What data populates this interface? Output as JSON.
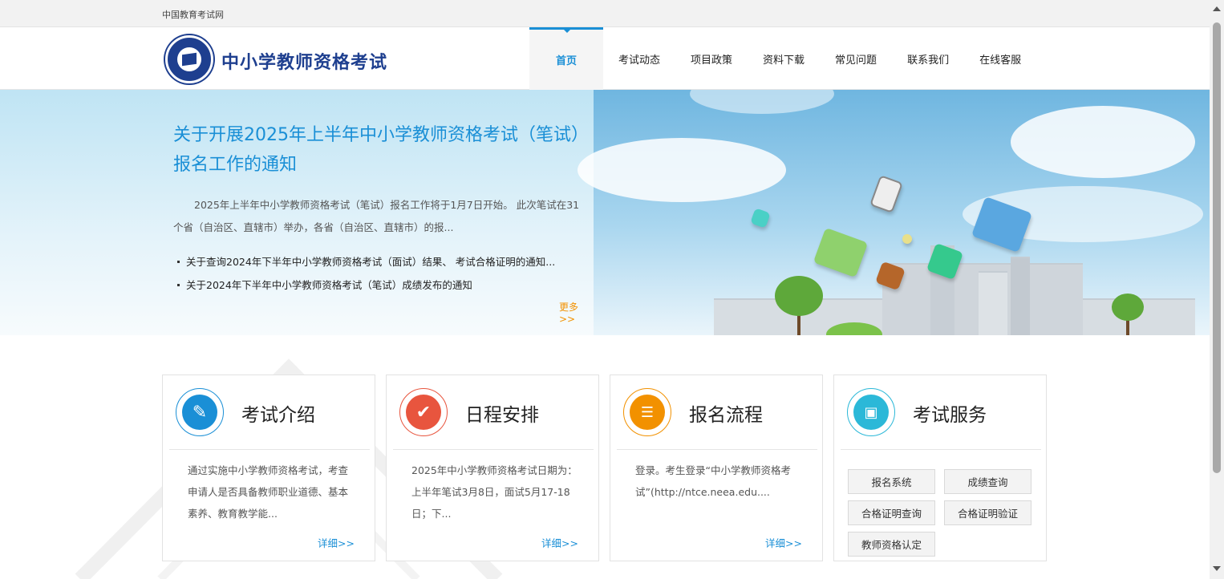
{
  "topbar": {
    "site_link": "中国教育考试网"
  },
  "header": {
    "title": "中小学教师资格考试",
    "nav": [
      "首页",
      "考试动态",
      "项目政策",
      "资料下载",
      "常见问题",
      "联系我们",
      "在线客服"
    ]
  },
  "banner": {
    "headline": "关于开展2025年上半年中小学教师资格考试（笔试）报名工作的通知",
    "summary": "2025年上半年中小学教师资格考试（笔试）报名工作将于1月7日开始。 此次笔试在31个省（自治区、直辖市）举办，各省（自治区、直辖市）的报...",
    "news": [
      "关于查询2024年下半年中小学教师资格考试（面试）结果、 考试合格证明的通知...",
      "关于2024年下半年中小学教师资格考试（笔试）成绩发布的通知"
    ],
    "more": "更多>>"
  },
  "cards": [
    {
      "title": "考试介绍",
      "text": "通过实施中小学教师资格考试，考查申请人是否具备教师职业道德、基本素养、教育教学能...",
      "more": "详细>>",
      "color": "#1a8fd6"
    },
    {
      "title": "日程安排",
      "text": "2025年中小学教师资格考试日期为：上半年笔试3月8日，面试5月17-18日；下...",
      "more": "详细>>",
      "color": "#e8553e"
    },
    {
      "title": "报名流程",
      "text": "登录。考生登录“中小学教师资格考试”(http://ntce.neea.edu....",
      "more": "详细>>",
      "color": "#f29100"
    },
    {
      "title": "考试服务",
      "color": "#2bb8d8",
      "buttons": [
        "报名系统",
        "成绩查询",
        "合格证明查询",
        "合格证明验证",
        "教师资格认定"
      ]
    }
  ]
}
